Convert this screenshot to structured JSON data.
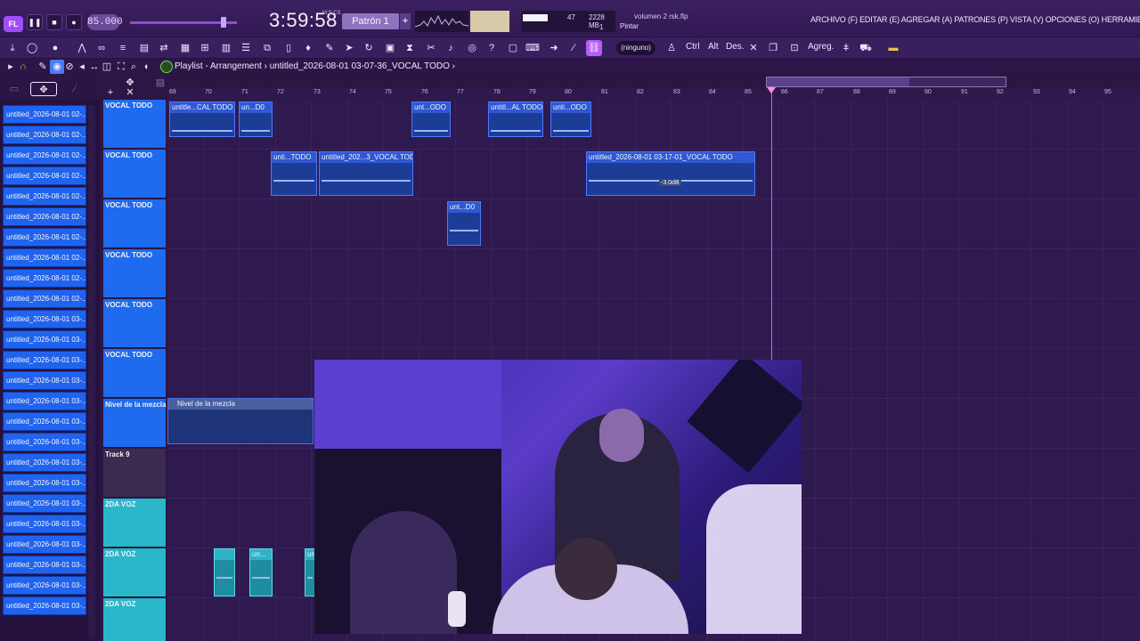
{
  "app": {
    "logo": "FL",
    "tempo": "85.000",
    "time": "3:59:58",
    "time_sub": "M:S:CS",
    "pattern": "Patrón 1",
    "pattern_add": "+",
    "cpu": {
      "val1": "47",
      "val2": "2228 MB",
      "val3": "1"
    },
    "file_hint": "volumen 2 rsk.flp",
    "mode_hint": "Pintar"
  },
  "menu": "ARCHIVO (F) EDITAR (E) AGREGAR (A) PATRONES (P) VISTA (V) OPCIONES (O) HERRAMIENTAS (T) AYUDA",
  "toolbar": {
    "ninguno": "(ninguno)",
    "ctrl": "Ctrl",
    "alt": "Alt",
    "des": "Des.",
    "agreg": "Agreg."
  },
  "playlist": {
    "title": "Playlist - Arrangement › untitled_2026-08-01 03-07-36_VOCAL TODO ›"
  },
  "browser_items": [
    "untitled_2026-08-01 02-...",
    "untitled_2026-08-01 02-...",
    "untitled_2026-08-01 02-...",
    "untitled_2026-08-01 02-...",
    "untitled_2026-08-01 02-...",
    "untitled_2026-08-01 02-...",
    "untitled_2026-08-01 02-...",
    "untitled_2026-08-01 02-...",
    "untitled_2026-08-01 02-...",
    "untitled_2026-08-01 02-...",
    "untitled_2026-08-01 03-...",
    "untitled_2026-08-01 03-...",
    "untitled_2026-08-01 03-...",
    "untitled_2026-08-01 03-...",
    "untitled_2026-08-01 03-...",
    "untitled_2026-08-01 03-...",
    "untitled_2026-08-01 03-...",
    "untitled_2026-08-01 03-...",
    "untitled_2026-08-01 03-...",
    "untitled_2026-08-01 03-...",
    "untitled_2026-08-01 03-...",
    "untitled_2026-08-01 03-...",
    "untitled_2026-08-01 03-...",
    "untitled_2026-08-01 03-...",
    "untitled_2026-08-01 03-..."
  ],
  "tracks": [
    {
      "name": "VOCAL TODO",
      "color": "blue"
    },
    {
      "name": "VOCAL TODO",
      "color": "blue"
    },
    {
      "name": "VOCAL TODO",
      "color": "blue"
    },
    {
      "name": "VOCAL TODO",
      "color": "blue"
    },
    {
      "name": "VOCAL TODO",
      "color": "blue"
    },
    {
      "name": "VOCAL TODO",
      "color": "blue"
    },
    {
      "name": "Nivel de la mezcla",
      "color": "blue"
    },
    {
      "name": "Track 9",
      "color": "gray"
    },
    {
      "name": "2DA VOZ",
      "color": "teal"
    },
    {
      "name": "2DA VOZ",
      "color": "teal"
    },
    {
      "name": "2DA VOZ",
      "color": "teal"
    }
  ],
  "ruler": [
    "69",
    "70",
    "71",
    "72",
    "73",
    "74",
    "75",
    "76",
    "77",
    "78",
    "79",
    "80",
    "81",
    "82",
    "83",
    "84",
    "85",
    "86",
    "87",
    "88",
    "89",
    "90",
    "91",
    "92",
    "93",
    "94",
    "95"
  ],
  "clips": [
    {
      "title": "untitle...CAL TODO"
    },
    {
      "title": "un...D0"
    },
    {
      "title": "unt...ODO"
    },
    {
      "title": "untitl...AL TODO"
    },
    {
      "title": "unti...ODO"
    },
    {
      "title": "unti...TODO"
    },
    {
      "title": "untitled_202...3_VOCAL TODO"
    },
    {
      "title": "untitled_2026-08-01 03-17-01_VOCAL TODO"
    },
    {
      "title": "unt...D0"
    },
    {
      "title": "un..."
    },
    {
      "title": "un..."
    }
  ],
  "gain_label": "-3.0dB",
  "mix_clip": "Nivel de la mezcla"
}
